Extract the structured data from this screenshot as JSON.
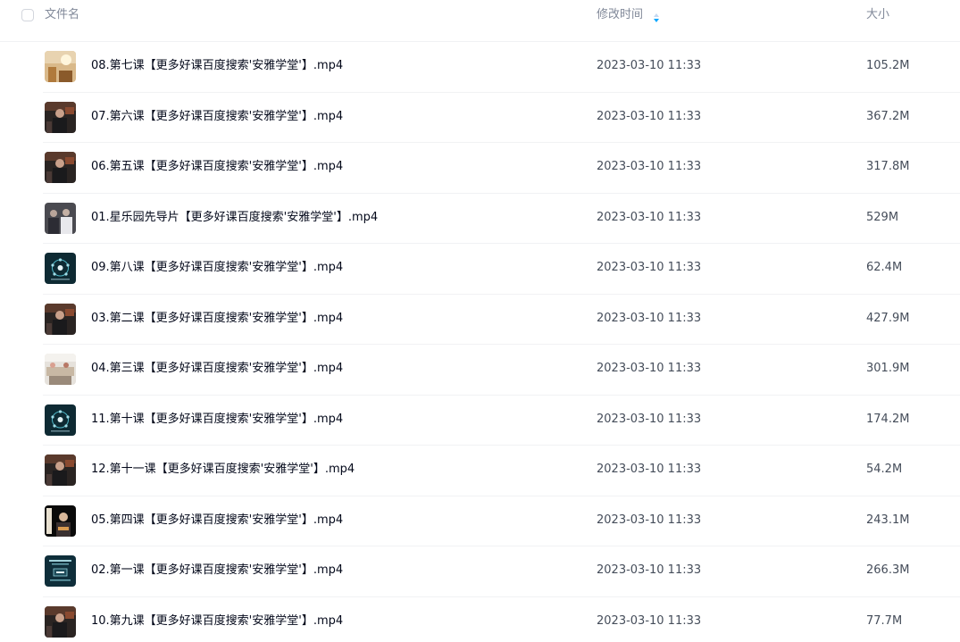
{
  "header": {
    "name_label": "文件名",
    "time_label": "修改时间",
    "size_label": "大小",
    "sort_color": "#06a7ff"
  },
  "files": [
    {
      "name": "08.第七课【更多好课百度搜索'安雅学堂'】.mp4",
      "time": "2023-03-10 11:33",
      "size": "105.2M",
      "thumb": "warm-stage"
    },
    {
      "name": "07.第六课【更多好课百度搜索'安雅学堂'】.mp4",
      "time": "2023-03-10 11:33",
      "size": "367.2M",
      "thumb": "speaker-dark"
    },
    {
      "name": "06.第五课【更多好课百度搜索'安雅学堂'】.mp4",
      "time": "2023-03-10 11:33",
      "size": "317.8M",
      "thumb": "speaker-dark"
    },
    {
      "name": "01.星乐园先导片【更多好课百度搜索'安雅学堂'】.mp4",
      "time": "2023-03-10 11:33",
      "size": "529M",
      "thumb": "people-gray"
    },
    {
      "name": "09.第八课【更多好课百度搜索'安雅学堂'】.mp4",
      "time": "2023-03-10 11:33",
      "size": "62.4M",
      "thumb": "diagram-teal"
    },
    {
      "name": "03.第二课【更多好课百度搜索'安雅学堂'】.mp4",
      "time": "2023-03-10 11:33",
      "size": "427.9M",
      "thumb": "speaker-dark"
    },
    {
      "name": "04.第三课【更多好课百度搜索'安雅学堂'】.mp4",
      "time": "2023-03-10 11:33",
      "size": "301.9M",
      "thumb": "table-light"
    },
    {
      "name": "11.第十课【更多好课百度搜索'安雅学堂'】.mp4",
      "time": "2023-03-10 11:33",
      "size": "174.2M",
      "thumb": "diagram-teal"
    },
    {
      "name": "12.第十一课【更多好课百度搜索'安雅学堂'】.mp4",
      "time": "2023-03-10 11:33",
      "size": "54.2M",
      "thumb": "speaker-dark"
    },
    {
      "name": "05.第四课【更多好课百度搜索'安雅学堂'】.mp4",
      "time": "2023-03-10 11:33",
      "size": "243.1M",
      "thumb": "portrait-black"
    },
    {
      "name": "02.第一课【更多好课百度搜索'安雅学堂'】.mp4",
      "time": "2023-03-10 11:33",
      "size": "266.3M",
      "thumb": "slide-teal"
    },
    {
      "name": "10.第九课【更多好课百度搜索'安雅学堂'】.mp4",
      "time": "2023-03-10 11:33",
      "size": "77.7M",
      "thumb": "speaker-dark"
    }
  ]
}
